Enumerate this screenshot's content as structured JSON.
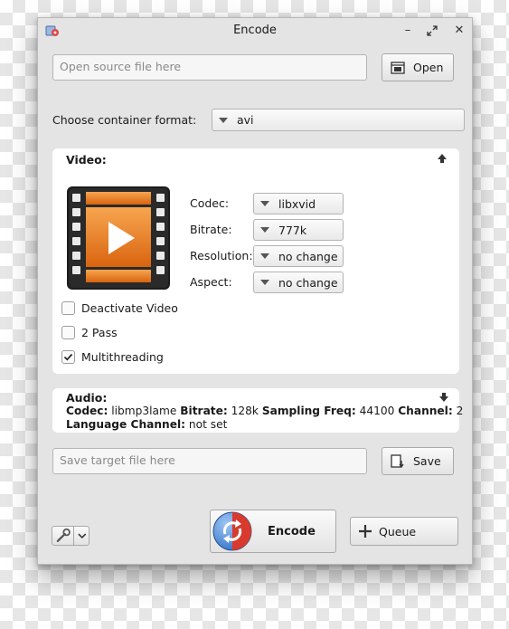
{
  "window": {
    "title": "Encode"
  },
  "source": {
    "placeholder": "Open source file here",
    "open_label": "Open"
  },
  "container": {
    "label": "Choose container format:",
    "value": "avi"
  },
  "video": {
    "title": "Video:",
    "codec_label": "Codec:",
    "codec_value": "libxvid",
    "bitrate_label": "Bitrate:",
    "bitrate_value": "777k",
    "resolution_label": "Resolution:",
    "resolution_value": "no change",
    "aspect_label": "Aspect:",
    "aspect_value": "no change",
    "checkboxes": [
      {
        "label": "Deactivate Video",
        "checked": false
      },
      {
        "label": "2 Pass",
        "checked": false
      },
      {
        "label": "Multithreading",
        "checked": true
      }
    ]
  },
  "audio": {
    "title": "Audio:",
    "codec_key": "Codec:",
    "codec_val": "libmp3lame",
    "bitrate_key": "Bitrate:",
    "bitrate_val": "128k",
    "freq_key": "Sampling Freq:",
    "freq_val": "44100",
    "channel_key": "Channel:",
    "channel_val": "2",
    "lang_key": "Language Channel:",
    "lang_val": "not set"
  },
  "target": {
    "placeholder": "Save target file here",
    "save_label": "Save"
  },
  "actions": {
    "encode_label": "Encode",
    "queue_label": "Queue"
  },
  "colors": {
    "window_bg": "#e4e4e4",
    "panel_bg": "#ffffff",
    "film_orange": "#e8761c",
    "encode_red": "#d83a2e",
    "encode_blue": "#2f6fc4"
  }
}
